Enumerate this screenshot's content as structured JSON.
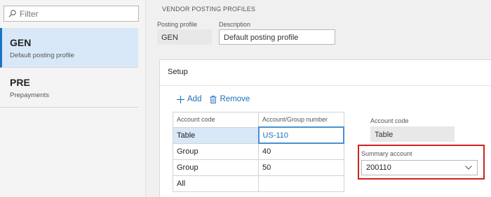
{
  "filter": {
    "placeholder": "Filter"
  },
  "list": [
    {
      "title": "GEN",
      "subtitle": "Default posting profile"
    },
    {
      "title": "PRE",
      "subtitle": "Prepayments"
    }
  ],
  "header": {
    "breadcrumb": "VENDOR POSTING PROFILES",
    "posting_profile_label": "Posting profile",
    "posting_profile_value": "GEN",
    "description_label": "Description",
    "description_value": "Default posting profile"
  },
  "setup": {
    "title": "Setup",
    "add_label": "Add",
    "remove_label": "Remove",
    "columns": [
      "Account code",
      "Account/Group number"
    ],
    "rows": [
      [
        "Table",
        "US-110"
      ],
      [
        "Group",
        "40"
      ],
      [
        "Group",
        "50"
      ],
      [
        "All",
        ""
      ]
    ],
    "account_code_label": "Account code",
    "account_code_value": "Table",
    "summary_account_label": "Summary account",
    "summary_account_value": "200110"
  },
  "colors": {
    "accent": "#1a74c2",
    "selected_bg": "#d8e8f8",
    "highlight": "#d02020"
  }
}
